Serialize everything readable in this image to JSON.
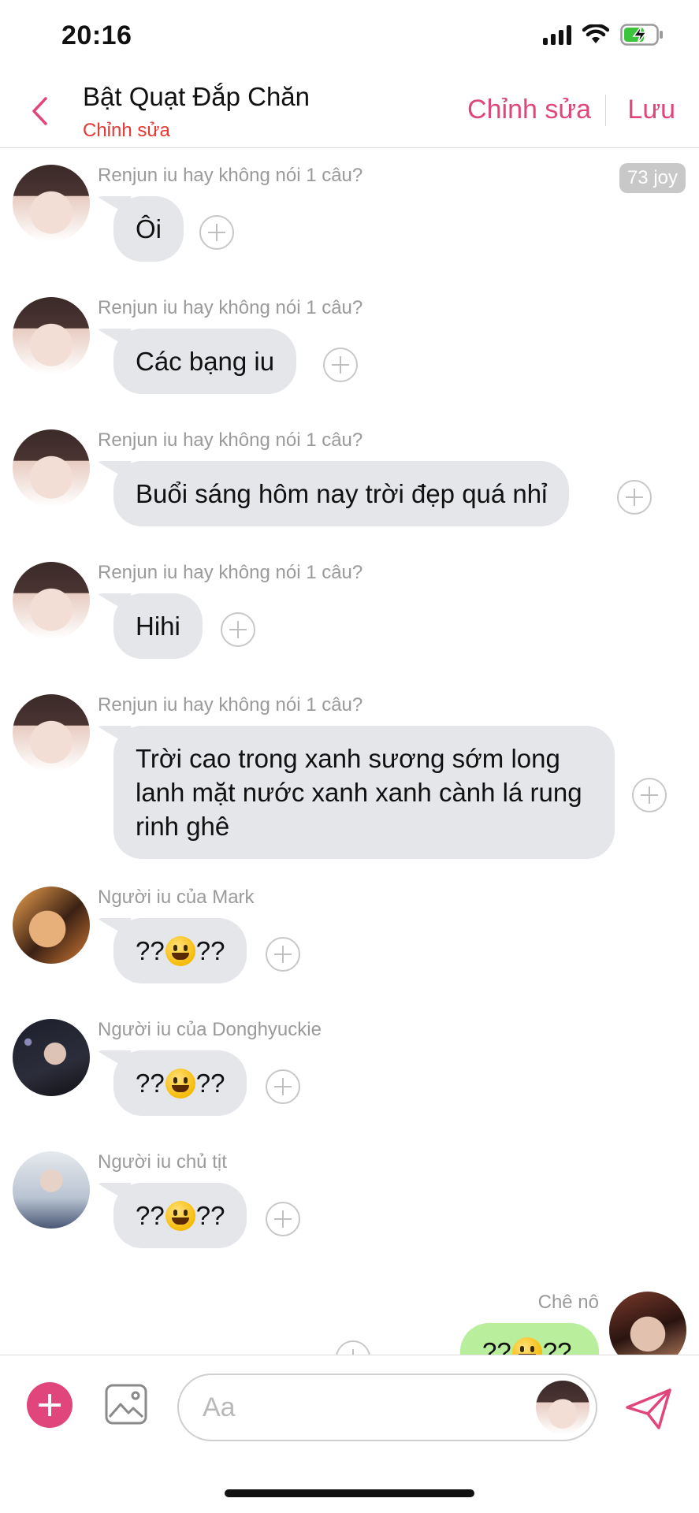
{
  "status_bar": {
    "time": "20:16"
  },
  "header": {
    "title": "Bật Quạt Đắp Chăn",
    "subtitle": "Chỉnh sửa",
    "edit_label": "Chỉnh sửa",
    "save_label": "Lưu"
  },
  "joy_badge": "73 joy",
  "messages": [
    {
      "sender": "Renjun iu hay không nói 1 câu?",
      "text": "Ôi"
    },
    {
      "sender": "Renjun iu hay không nói 1 câu?",
      "text": "Các bạng iu"
    },
    {
      "sender": "Renjun iu hay không nói 1 câu?",
      "text": "Buổi sáng hôm nay trời đẹp quá nhỉ"
    },
    {
      "sender": "Renjun iu hay không nói 1 câu?",
      "text": "Hihi"
    },
    {
      "sender": "Renjun iu hay không nói 1 câu?",
      "text": "Trời cao trong xanh sương sớm long lanh mặt nước xanh xanh cành lá rung rinh ghê"
    },
    {
      "sender": "Người iu của Mark",
      "text_before": "??",
      "emoji": "grinning-face",
      "text_after": "??"
    },
    {
      "sender": "Người iu của Donghyuckie",
      "text_before": "??",
      "emoji": "grinning-face",
      "text_after": "??"
    },
    {
      "sender": "Người iu chủ tịt",
      "text_before": "??",
      "emoji": "grinning-face",
      "text_after": "??"
    }
  ],
  "own_message": {
    "sender": "Chê nô",
    "text_before": "??",
    "emoji": "grinning-face",
    "text_after": "??"
  },
  "composer": {
    "placeholder": "Aa"
  },
  "colors": {
    "accent": "#e0457b",
    "subtitle": "#e53935",
    "bubble": "#e4e6e9",
    "own_bubble": "#b9ef9c"
  }
}
